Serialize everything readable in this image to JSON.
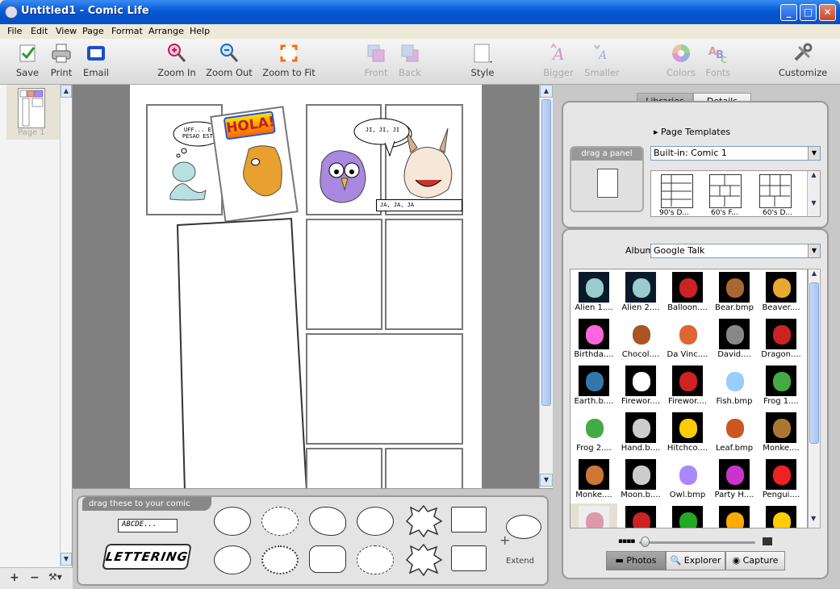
{
  "window": {
    "title": "Untitled1 - Comic Life"
  },
  "menu": [
    "File",
    "Edit",
    "View",
    "Page",
    "Format",
    "Arrange",
    "Help"
  ],
  "toolbar": {
    "save": "Save",
    "print": "Print",
    "email": "Email",
    "zoom_in": "Zoom In",
    "zoom_out": "Zoom Out",
    "zoom_fit": "Zoom to Fit",
    "front": "Front",
    "back": "Back",
    "style": "Style",
    "bigger": "Bigger",
    "smaller": "Smaller",
    "colors": "Colors",
    "fonts": "Fonts",
    "customize": "Customize"
  },
  "pages": {
    "thumb_label": "Page 1",
    "add": "+",
    "remove": "−"
  },
  "comic": {
    "bubble1": "UFF... EL PESAO ESTE",
    "bubble2": "JI, JI, JI",
    "caption": "JA, JA, JA",
    "hola": "HOLA!"
  },
  "tray": {
    "header": "drag these to your comic",
    "caption_sample": "ABCDE...",
    "lettering": "LETTERING",
    "extend": "Extend"
  },
  "right": {
    "tab_libraries": "Libraries",
    "tab_details": "Details",
    "templates_header": "Page Templates",
    "drag_panel": "drag a panel",
    "template_select": "Built-in: Comic 1",
    "template_labels": [
      "90's D...",
      "60's F...",
      "60's D..."
    ],
    "album_label": "Album:",
    "album_select": "Google Talk",
    "images": [
      "Alien 1....",
      "Alien 2....",
      "Balloon....",
      "Bear.bmp",
      "Beaver....",
      "Birthda....",
      "Chocol....",
      "Da Vinc....",
      "David....",
      "Dragon....",
      "Earth.b....",
      "Firewor....",
      "Firewor....",
      "Fish.bmp",
      "Frog 1....",
      "Frog 2....",
      "Hand.b....",
      "Hitchco....",
      "Leaf.bmp",
      "Monke....",
      "Monke....",
      "Moon.b....",
      "Owl.bmp",
      "Party H....",
      "Pengui....",
      "",
      "",
      "",
      "",
      ""
    ],
    "tab_photos": "Photos",
    "tab_explorer": "Explorer",
    "tab_capture": "Capture"
  },
  "colors": {
    "titlebar": "#0a5fd8",
    "accent": "#316ac5"
  }
}
